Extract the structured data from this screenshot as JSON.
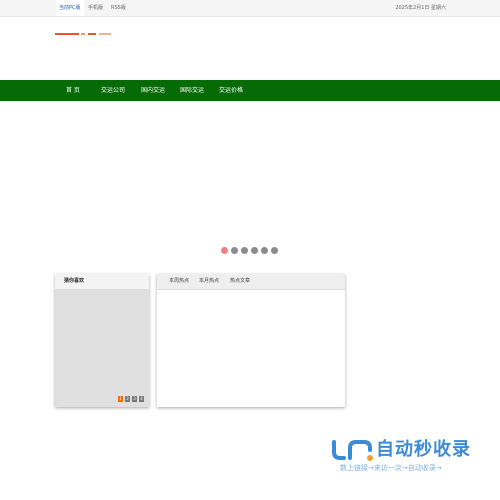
{
  "topbar": {
    "links": [
      "当前PC版",
      "手机版",
      "RSS版"
    ],
    "date": "2025年2月1日 星期六"
  },
  "nav": {
    "items": [
      "首 页",
      "交运公司",
      "国内交运",
      "国际交运",
      "交运价格"
    ]
  },
  "colors": {
    "nav_bg": "#066b06",
    "slider_dot_active": "#f07f86",
    "slider_dot": "#8a8a8a",
    "pager_active": "#f06a10",
    "logo_primary": "#e8562a"
  },
  "slider": {
    "dot_count": 6,
    "active_index": 0
  },
  "left_panel": {
    "title": "猜你喜欢",
    "pages": [
      "1",
      "2",
      "3",
      "4"
    ],
    "active_page": "1"
  },
  "right_panel": {
    "tabs": [
      "本周热点",
      "本月热点",
      "热点文章"
    ]
  },
  "watermark": {
    "logo_text": "自动秒收录",
    "subtitle": "数上链接→来访一次→自动收录→"
  }
}
